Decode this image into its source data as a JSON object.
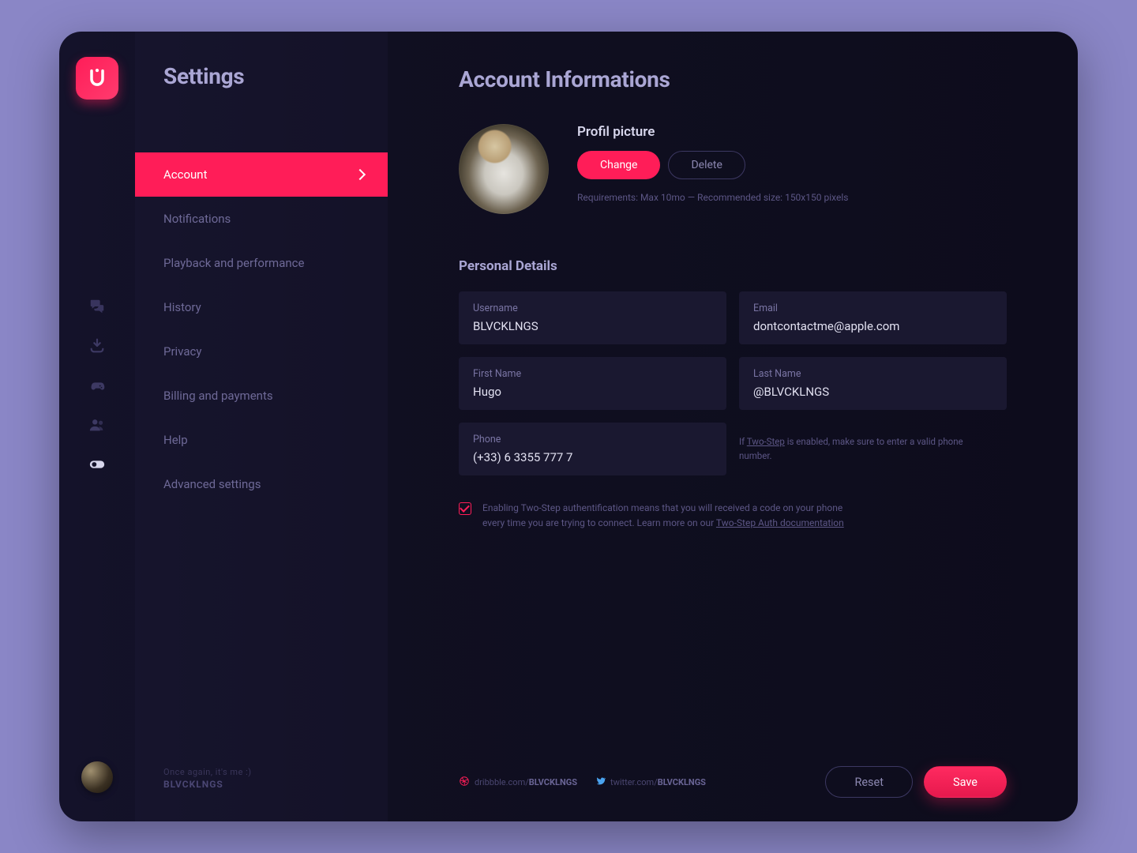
{
  "sidebar": {
    "title": "Settings",
    "items": [
      {
        "label": "Account",
        "active": true
      },
      {
        "label": "Notifications"
      },
      {
        "label": "Playback and performance"
      },
      {
        "label": "History"
      },
      {
        "label": "Privacy"
      },
      {
        "label": "Billing and payments"
      },
      {
        "label": "Help"
      },
      {
        "label": "Advanced settings"
      }
    ],
    "footer_tag": "Once again, it's me  :)",
    "footer_name": "BLVCKLNGS"
  },
  "main": {
    "title": "Account Informations",
    "profile": {
      "heading": "Profil picture",
      "change": "Change",
      "delete": "Delete",
      "hint": "Requirements: Max 10mo — Recommended size: 150x150 pixels"
    },
    "details": {
      "heading": "Personal Details",
      "username_label": "Username",
      "username": "BLVCKLNGS",
      "email_label": "Email",
      "email": "dontcontactme@apple.com",
      "firstname_label": "First Name",
      "firstname": "Hugo",
      "lastname_label": "Last Name",
      "lastname": "@BLVCKLNGS",
      "phone_label": "Phone",
      "phone": "(+33) 6 3355 777 7",
      "phone_hint_pre": "If ",
      "phone_hint_link": "Two-Step",
      "phone_hint_post": " is enabled, make sure to enter a valid phone number."
    },
    "twostep": {
      "text_pre": "Enabling Two-Step authentification means that you will received a code on your phone every time you are trying to connect. Learn more on our ",
      "link": "Two-Step Auth documentation"
    },
    "footer": {
      "dribbble_pre": "dribbble.com/",
      "dribbble_name": "BLVCKLNGS",
      "twitter_pre": "twitter.com/",
      "twitter_name": "BLVCKLNGS",
      "reset": "Reset",
      "save": "Save"
    }
  },
  "colors": {
    "accent": "#ff1d58"
  }
}
